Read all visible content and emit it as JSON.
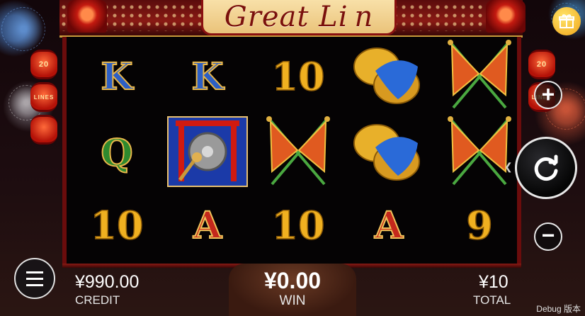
{
  "header": {
    "logo_text": "Great Li n"
  },
  "lines": {
    "left": [
      "20",
      "LINES"
    ],
    "right": [
      "20",
      "LINES"
    ]
  },
  "reels": [
    [
      "K",
      "Q",
      "10"
    ],
    [
      "K",
      "gong",
      "A"
    ],
    [
      "10",
      "flags",
      "10"
    ],
    [
      "cymbals",
      "cymbals",
      "A"
    ],
    [
      "flags",
      "flags",
      "9"
    ]
  ],
  "symbols": {
    "K": {
      "type": "letter",
      "style": "blue"
    },
    "Q": {
      "type": "letter",
      "style": "green"
    },
    "A": {
      "type": "letter",
      "style": "red"
    },
    "10": {
      "type": "letter",
      "style": "gold"
    },
    "9": {
      "type": "letter",
      "style": "gold"
    },
    "gong": {
      "type": "icon",
      "icon": "gong-icon"
    },
    "cymbals": {
      "type": "icon",
      "icon": "cymbals-icon"
    },
    "flags": {
      "type": "icon",
      "icon": "crossed-flags-icon"
    }
  },
  "colors": {
    "frame_red": "#8a1a14",
    "gold": "#f0b020",
    "lantern": "#b41208"
  },
  "credit": {
    "value": "¥990.00",
    "label": "CREDIT"
  },
  "win": {
    "value": "¥0.00",
    "label": "WIN"
  },
  "total": {
    "value": "¥10",
    "label": "TOTAL"
  },
  "controls": {
    "plus": "+",
    "minus": "−",
    "spin_icon": "refresh-icon",
    "menu_icon": "menu-icon",
    "gift_icon": "gift-icon"
  },
  "debug_text": "Debug 版本"
}
